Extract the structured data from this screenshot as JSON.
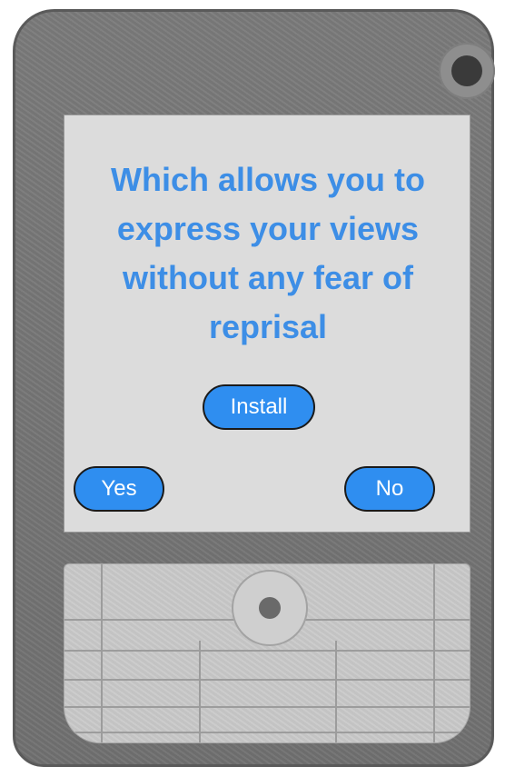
{
  "screen": {
    "headline": "Which allows you to express your views without any fear of reprisal",
    "install_label": "Install",
    "yes_label": "Yes",
    "no_label": "No"
  },
  "colors": {
    "accent": "#3d8ee6",
    "button_fill": "#2f8ef0",
    "phone_body": "#757575",
    "screen_bg": "#dcdcdc"
  }
}
